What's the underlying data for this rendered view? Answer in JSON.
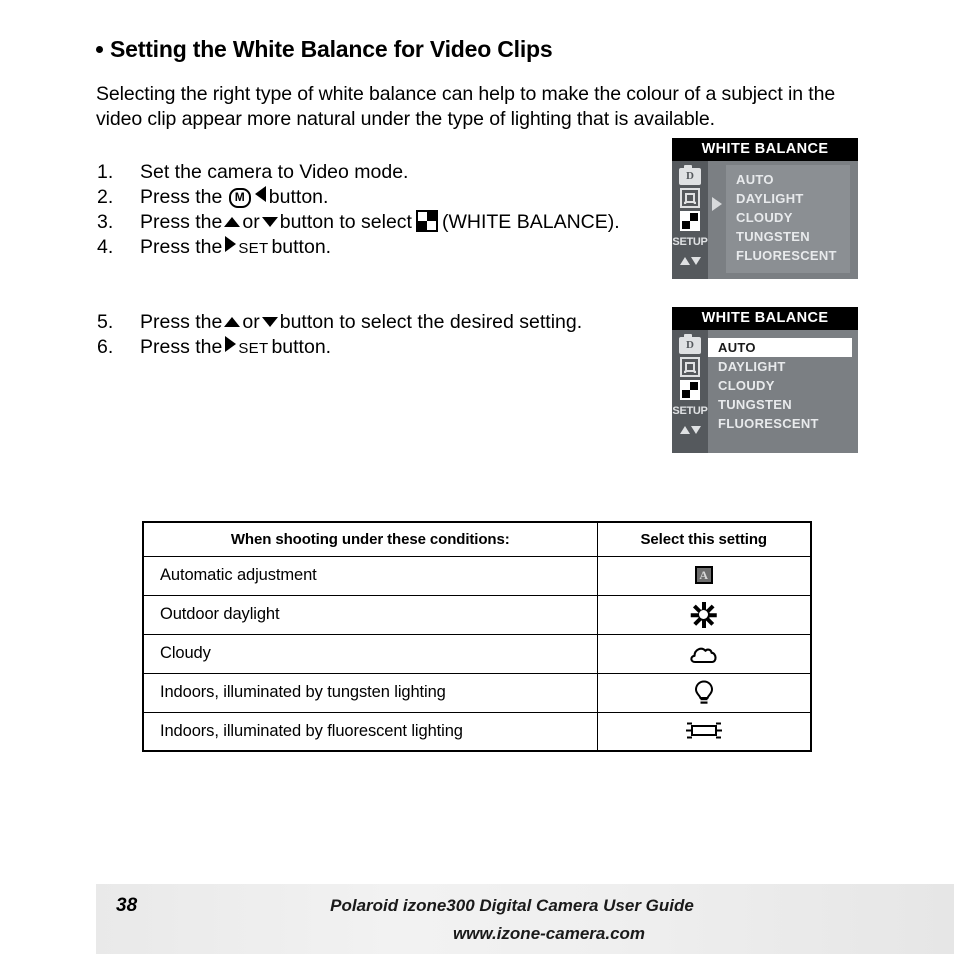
{
  "heading": {
    "bullet": "•",
    "title": "Setting the White Balance for Video Clips"
  },
  "intro": "Selecting the right type of white balance can help to make the colour of a subject in the video clip appear more natural under the type of lighting that is available.",
  "steps_block_a": [
    {
      "num": "1.",
      "pre": "Set the camera to Video mode.",
      "post": ""
    },
    {
      "num": "2.",
      "pre": "Press the",
      "mid_icon": "mode-m-button",
      "post": "button."
    },
    {
      "num": "3.",
      "pre": "Press the",
      "mid": "or",
      "post": "button to select",
      "tail": "(WHITE BALANCE)."
    },
    {
      "num": "4.",
      "pre": "Press the",
      "set_label": "SET",
      "post": "button."
    }
  ],
  "steps_block_b": [
    {
      "num": "5.",
      "pre": "Press the",
      "mid": "or",
      "post": "button to select the desired setting."
    },
    {
      "num": "6.",
      "pre": "Press the",
      "set_label": "SET",
      "post": "button."
    }
  ],
  "lcd_screen_1": {
    "title": "WHITE BALANCE",
    "sidebar_icons": [
      "camera-d-icon",
      "resolution-icon",
      "white-balance-icon",
      "setup-icon",
      "up-down-arrows-icon"
    ],
    "setup_label": "SETUP",
    "menu_items": [
      "AUTO",
      "DAYLIGHT",
      "CLOUDY",
      "TUNGSTEN",
      "FLUORESCENT"
    ],
    "selected_index": -1,
    "pointer_arrow": true
  },
  "lcd_screen_2": {
    "title": "WHITE BALANCE",
    "sidebar_icons": [
      "camera-d-icon",
      "resolution-icon",
      "white-balance-icon",
      "setup-icon",
      "up-down-arrows-icon"
    ],
    "setup_label": "SETUP",
    "menu_items": [
      "AUTO",
      "DAYLIGHT",
      "CLOUDY",
      "TUNGSTEN",
      "FLUORESCENT"
    ],
    "selected_index": 0,
    "pointer_arrow": false
  },
  "table": {
    "headers": [
      "When shooting under these conditions:",
      "Select this setting"
    ],
    "rows": [
      {
        "condition": "Automatic adjustment",
        "icon": "auto-a-icon"
      },
      {
        "condition": "Outdoor daylight",
        "icon": "sun-icon"
      },
      {
        "condition": "Cloudy",
        "icon": "cloud-icon"
      },
      {
        "condition": "Indoors, illuminated by tungsten lighting",
        "icon": "lightbulb-icon"
      },
      {
        "condition": "Indoors, illuminated by fluorescent lighting",
        "icon": "fluorescent-tube-icon"
      }
    ]
  },
  "footer": {
    "page_number": "38",
    "guide_title": "Polaroid izone300 Digital Camera User Guide",
    "website": "www.izone-camera.com"
  },
  "colors": {
    "lcd_background": "#7b7f83",
    "lcd_sidebar": "#55595d",
    "lcd_list": "#8b8f93",
    "lcd_title_bar": "#000000",
    "selected_row": "#ffffff",
    "text": "#000000"
  }
}
